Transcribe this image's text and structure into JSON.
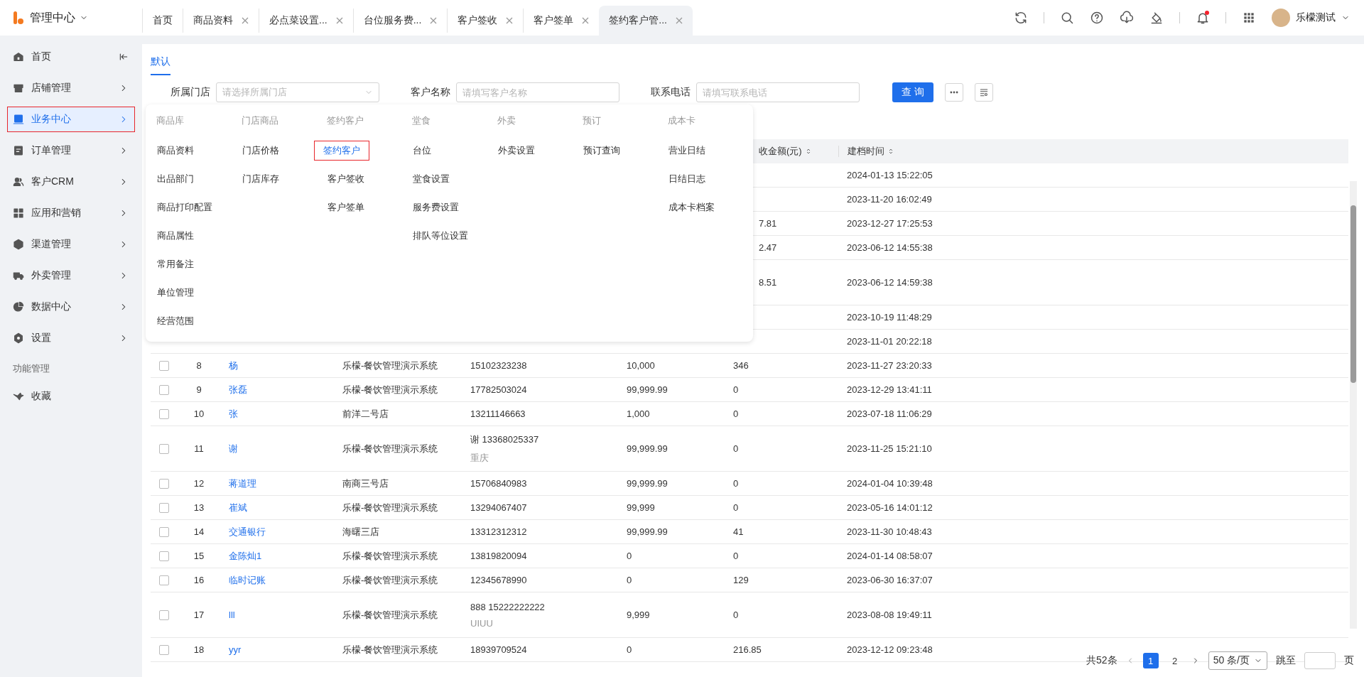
{
  "app": {
    "title": "管理中心"
  },
  "tabs": [
    {
      "label": "首页",
      "closable": false,
      "selected": false
    },
    {
      "label": "商品资料",
      "closable": true,
      "selected": false
    },
    {
      "label": "必点菜设置...",
      "closable": true,
      "selected": false
    },
    {
      "label": "台位服务费...",
      "closable": true,
      "selected": false
    },
    {
      "label": "客户签收",
      "closable": true,
      "selected": false
    },
    {
      "label": "客户签单",
      "closable": true,
      "selected": false
    },
    {
      "label": "签约客户管...",
      "closable": true,
      "selected": true
    }
  ],
  "toolbar": {
    "notification_dot": true,
    "user": "乐檬测试"
  },
  "sidebar": {
    "items": [
      {
        "label": "首页",
        "selected": false,
        "annotated": false
      },
      {
        "label": "店铺管理",
        "selected": false,
        "annotated": false
      },
      {
        "label": "业务中心",
        "selected": true,
        "annotated": true
      },
      {
        "label": "订单管理",
        "selected": false,
        "annotated": false
      },
      {
        "label": "客户CRM",
        "selected": false,
        "annotated": false
      },
      {
        "label": "应用和营销",
        "selected": false,
        "annotated": false
      },
      {
        "label": "渠道管理",
        "selected": false,
        "annotated": false
      },
      {
        "label": "外卖管理",
        "selected": false,
        "annotated": false
      },
      {
        "label": "数据中心",
        "selected": false,
        "annotated": false
      },
      {
        "label": "设置",
        "selected": false,
        "annotated": false
      }
    ],
    "section": "功能管理",
    "extra_items": [
      {
        "label": "收藏"
      }
    ]
  },
  "view_tabs": [
    {
      "label": "默认",
      "selected": true
    }
  ],
  "filters": [
    {
      "label": "所属门店",
      "kind": "select",
      "placeholder": "请选择所属门店"
    },
    {
      "label": "客户名称",
      "kind": "input",
      "placeholder": "请填写客户名称"
    },
    {
      "label": "联系电话",
      "kind": "input",
      "placeholder": "请填写联系电话"
    }
  ],
  "query_button": "查 询",
  "menu": {
    "columns": [
      {
        "title": "商品库",
        "items": [
          {
            "label": "商品资料",
            "selected": false,
            "annotated": false
          },
          {
            "label": "出品部门",
            "selected": false,
            "annotated": false
          },
          {
            "label": "商品打印配置",
            "selected": false,
            "annotated": false
          },
          {
            "label": "商品属性",
            "selected": false,
            "annotated": false
          },
          {
            "label": "常用备注",
            "selected": false,
            "annotated": false
          },
          {
            "label": "单位管理",
            "selected": false,
            "annotated": false
          },
          {
            "label": "经营范围",
            "selected": false,
            "annotated": false
          }
        ]
      },
      {
        "title": "门店商品",
        "items": [
          {
            "label": "门店价格",
            "selected": false,
            "annotated": false
          },
          {
            "label": "门店库存",
            "selected": false,
            "annotated": false
          }
        ]
      },
      {
        "title": "签约客户",
        "items": [
          {
            "label": "签约客户",
            "selected": true,
            "annotated": true
          },
          {
            "label": "客户签收",
            "selected": false,
            "annotated": false
          },
          {
            "label": "客户签单",
            "selected": false,
            "annotated": false
          }
        ]
      },
      {
        "title": "堂食",
        "items": [
          {
            "label": "台位",
            "selected": false,
            "annotated": false
          },
          {
            "label": "堂食设置",
            "selected": false,
            "annotated": false
          },
          {
            "label": "服务费设置",
            "selected": false,
            "annotated": false
          },
          {
            "label": "排队等位设置",
            "selected": false,
            "annotated": false
          }
        ]
      },
      {
        "title": "外卖",
        "items": [
          {
            "label": "外卖设置",
            "selected": false,
            "annotated": false
          }
        ]
      },
      {
        "title": "预订",
        "items": [
          {
            "label": "预订查询",
            "selected": false,
            "annotated": false
          }
        ]
      },
      {
        "title": "成本卡",
        "items": [
          {
            "label": "营业日结",
            "selected": false,
            "annotated": false
          },
          {
            "label": "日结日志",
            "selected": false,
            "annotated": false
          },
          {
            "label": "成本卡档案",
            "selected": false,
            "annotated": false
          }
        ]
      }
    ]
  },
  "table": {
    "header": [
      {
        "label": "收金额(元)",
        "sortable": true,
        "covered": true
      },
      {
        "label": "建档时间",
        "sortable": true,
        "covered": false
      }
    ],
    "rows": [
      {
        "kind": "covered",
        "tall": false,
        "created": "2024-01-13 15:22:05"
      },
      {
        "kind": "covered",
        "tall": false,
        "created": "2023-11-20 16:02:49"
      },
      {
        "kind": "covered",
        "tall": false,
        "amount": "7.81",
        "created": "2023-12-27 17:25:53"
      },
      {
        "kind": "covered",
        "tall": false,
        "amount": "2.47",
        "created": "2023-06-12 14:55:38"
      },
      {
        "kind": "covered",
        "tall": true,
        "amount": "8.51",
        "created": "2023-06-12 14:59:38"
      },
      {
        "kind": "covered",
        "tall": false,
        "created": "2023-10-19 11:48:29"
      },
      {
        "kind": "covered",
        "tall": false,
        "created": "2023-11-01 20:22:18"
      },
      {
        "kind": "full",
        "checked": false,
        "index": "8",
        "name": "杨",
        "store": "乐檬-餐饮管理演示系统",
        "phone": "15102323238",
        "credit": "10,000",
        "amount": "346",
        "created": "2023-11-27 23:20:33"
      },
      {
        "kind": "full",
        "checked": false,
        "index": "9",
        "name": "张磊",
        "store": "乐檬-餐饮管理演示系统",
        "phone": "17782503024",
        "credit": "99,999.99",
        "amount": "0",
        "created": "2023-12-29 13:41:11"
      },
      {
        "kind": "full",
        "checked": false,
        "index": "10",
        "name": "张",
        "store": "前洋二号店",
        "phone": "13211146663",
        "credit": "1,000",
        "amount": "0",
        "created": "2023-07-18 11:06:29"
      },
      {
        "kind": "full",
        "checked": false,
        "index": "11",
        "name": "谢",
        "store": "乐檬-餐饮管理演示系统",
        "phone": "谢 13368025337",
        "phone_note": "重庆",
        "credit": "99,999.99",
        "amount": "0",
        "created": "2023-11-25 15:21:10"
      },
      {
        "kind": "full",
        "checked": false,
        "index": "12",
        "name": "蒋道理",
        "store": "南商三号店",
        "phone": "15706840983",
        "credit": "99,999.99",
        "amount": "0",
        "created": "2024-01-04 10:39:48"
      },
      {
        "kind": "full",
        "checked": false,
        "index": "13",
        "name": "崔斌",
        "store": "乐檬-餐饮管理演示系统",
        "phone": "13294067407",
        "credit": "99,999",
        "amount": "0",
        "created": "2023-05-16 14:01:12"
      },
      {
        "kind": "full",
        "checked": false,
        "index": "14",
        "name": "交通银行",
        "store": "海曙三店",
        "phone": "13312312312",
        "credit": "99,999.99",
        "amount": "41",
        "created": "2023-11-30 10:48:43"
      },
      {
        "kind": "full",
        "checked": false,
        "index": "15",
        "name": "金陈灿1",
        "store": "乐檬-餐饮管理演示系统",
        "phone": "13819820094",
        "credit": "0",
        "amount": "0",
        "created": "2024-01-14 08:58:07"
      },
      {
        "kind": "full",
        "checked": false,
        "index": "16",
        "name": "临时记账",
        "store": "乐檬-餐饮管理演示系统",
        "phone": "12345678990",
        "credit": "0",
        "amount": "129",
        "created": "2023-06-30 16:37:07"
      },
      {
        "kind": "full",
        "checked": false,
        "index": "17",
        "name": "lll",
        "store": "乐檬-餐饮管理演示系统",
        "phone": "888 15222222222",
        "phone_note": "UIUU",
        "credit": "9,999",
        "amount": "0",
        "created": "2023-08-08 19:49:11"
      },
      {
        "kind": "full",
        "checked": false,
        "index": "18",
        "name": "yyr",
        "store": "乐檬-餐饮管理演示系统",
        "phone": "18939709524",
        "credit": "0",
        "amount": "216.85",
        "created": "2023-12-12 09:23:48"
      }
    ]
  },
  "pagination": {
    "total": "共52条",
    "pages": [
      {
        "label": "1",
        "selected": true
      },
      {
        "label": "2",
        "selected": false
      }
    ],
    "page_size": "50 条/页",
    "jump_label": "跳至",
    "page_suffix": "页"
  }
}
